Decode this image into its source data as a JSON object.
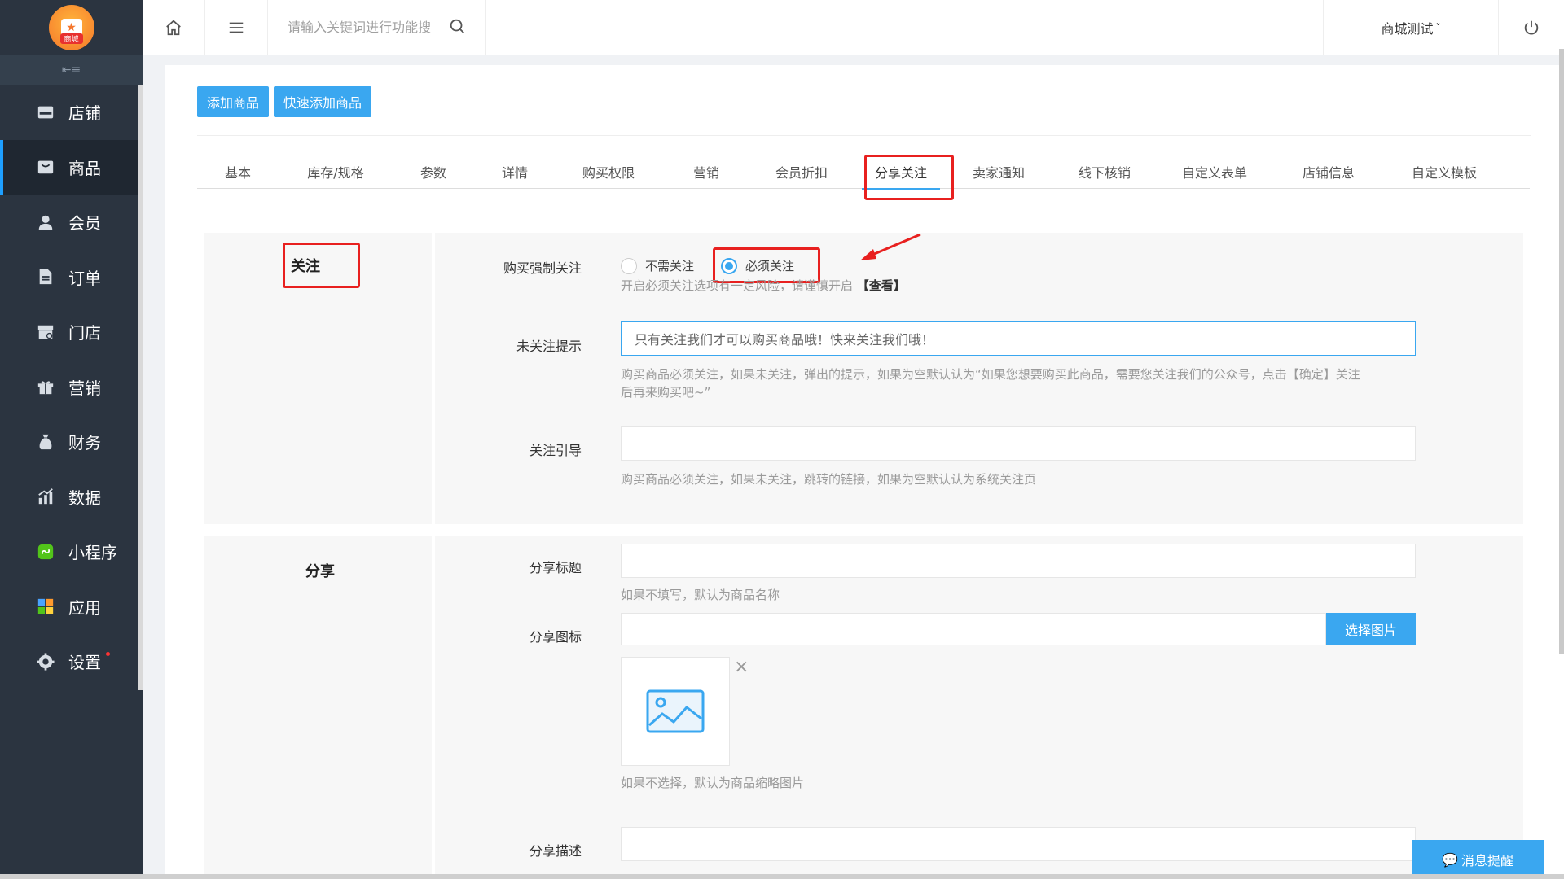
{
  "sidebar": {
    "logo_text": "商城",
    "collapse_icon": "collapse-icon",
    "items": [
      {
        "label": "店铺",
        "icon": "store-icon",
        "active": false
      },
      {
        "label": "商品",
        "icon": "goods-icon",
        "active": true
      },
      {
        "label": "会员",
        "icon": "member-icon",
        "active": false
      },
      {
        "label": "订单",
        "icon": "order-icon",
        "active": false
      },
      {
        "label": "门店",
        "icon": "shop-icon",
        "active": false
      },
      {
        "label": "营销",
        "icon": "gift-icon",
        "active": false
      },
      {
        "label": "财务",
        "icon": "money-bag-icon",
        "active": false
      },
      {
        "label": "数据",
        "icon": "chart-icon",
        "active": false
      },
      {
        "label": "小程序",
        "icon": "miniprogram-icon",
        "active": false
      },
      {
        "label": "应用",
        "icon": "apps-icon",
        "active": false
      },
      {
        "label": "设置",
        "icon": "gear-icon",
        "active": false
      }
    ]
  },
  "topbar": {
    "search_placeholder": "请输入关键词进行功能搜",
    "store_name": "商城测试",
    "store_chevron": "˅"
  },
  "toolbar": {
    "add_goods": "添加商品",
    "quick_add_goods": "快速添加商品"
  },
  "tabs": [
    "基本",
    "库存/规格",
    "参数",
    "详情",
    "购买权限",
    "营销",
    "会员折扣",
    "分享关注",
    "卖家通知",
    "线下核销",
    "自定义表单",
    "店铺信息",
    "自定义模板"
  ],
  "follow_section": {
    "title": "关注",
    "force_follow_label": "购买强制关注",
    "options": [
      "不需关注",
      "必须关注"
    ],
    "selected_option": "必须关注",
    "force_follow_help": "开启必须关注选项有一定风险，请谨慎开启",
    "force_follow_link": "【查看】",
    "unfollow_tip_label": "未关注提示",
    "unfollow_tip_value": "只有关注我们才可以购买商品哦！快来关注我们哦！",
    "unfollow_tip_help_1": "购买商品必须关注，如果未关注，弹出的提示，如果为空默认认为“如果您想要购买此商品，需要您关注我们的公众号，点击【确定】关注",
    "unfollow_tip_help_2": "后再来购买吧~”",
    "guide_label": "关注引导",
    "guide_value": "",
    "guide_help": "购买商品必须关注，如果未关注，跳转的链接，如果为空默认认为系统关注页"
  },
  "share_section": {
    "title": "分享",
    "share_title_label": "分享标题",
    "share_title_value": "",
    "share_title_help": "如果不填写，默认为商品名称",
    "share_icon_label": "分享图标",
    "select_image_button": "选择图片",
    "share_icon_help": "如果不选择，默认为商品缩略图片",
    "share_desc_label": "分享描述"
  },
  "message_button": "消息提醒",
  "colors": {
    "sidebar_bg": "#2b3440",
    "accent": "#3aa7f0",
    "highlight_red": "#e8201f"
  }
}
